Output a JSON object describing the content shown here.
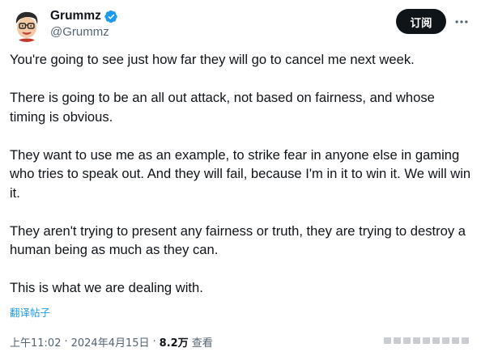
{
  "author": {
    "display_name": "Grummz",
    "handle": "@Grummz",
    "verified": true,
    "avatar_icon": "cartoon-face-glasses-avatar"
  },
  "actions": {
    "subscribe_label": "订阅",
    "more_icon": "more-horizontal-icon"
  },
  "tweet": {
    "paragraphs": [
      "You're going to see just how far they will go to cancel me next week.",
      "There is going to be an all out attack, not based on fairness, and whose timing is obvious.",
      "They want to use me as an example, to strike fear in anyone else in gaming who tries to speak out. And they will fail, because I'm in it to win it. We will win it.",
      "They aren't trying to present any fairness or truth, they are trying to destroy a human being as much as they can.",
      "This is what we are dealing with."
    ],
    "translate_label": "翻译帖子"
  },
  "meta": {
    "time": "上午11:02",
    "separator": "·",
    "date": "2024年4月15日",
    "views_count": "8.2万",
    "views_label": "查看"
  },
  "colors": {
    "accent": "#1d9bf0",
    "text": "#0f1419",
    "muted": "#536471",
    "button_bg": "#0f1419"
  }
}
